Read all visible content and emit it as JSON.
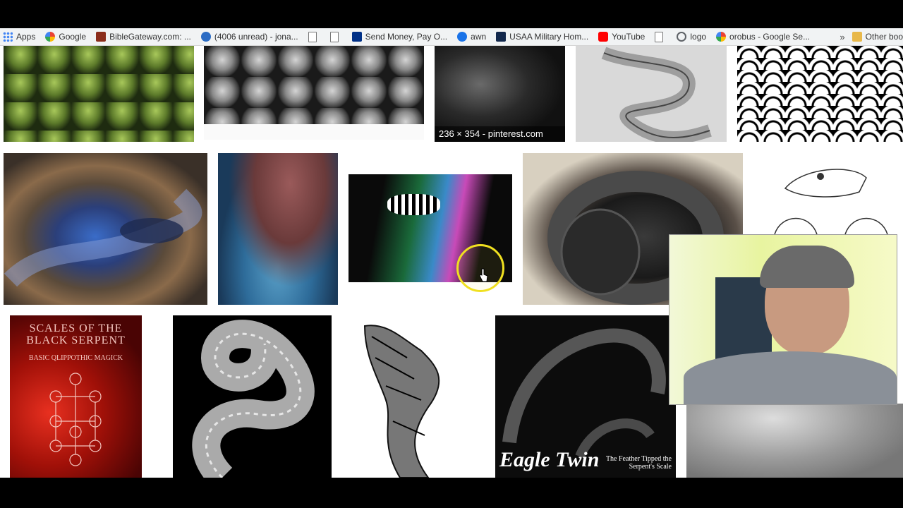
{
  "bookmarks_bar": {
    "items": [
      {
        "label": "Apps",
        "icon": "apps-grid-icon"
      },
      {
        "label": "Google",
        "icon": "google-icon"
      },
      {
        "label": "BibleGateway.com: ...",
        "icon": "biblegateway-icon"
      },
      {
        "label": "(4006 unread) - jona...",
        "icon": "mail-icon"
      },
      {
        "label": "",
        "icon": "page-icon"
      },
      {
        "label": "",
        "icon": "page-icon"
      },
      {
        "label": "Send Money, Pay O...",
        "icon": "paypal-icon"
      },
      {
        "label": "awn",
        "icon": "awn-icon"
      },
      {
        "label": "USAA Military Hom...",
        "icon": "usaa-icon"
      },
      {
        "label": "YouTube",
        "icon": "youtube-icon"
      },
      {
        "label": "",
        "icon": "page-icon"
      },
      {
        "label": "logo",
        "icon": "logo-icon"
      },
      {
        "label": "orobus - Google Se...",
        "icon": "google-icon"
      }
    ],
    "overflow": "»",
    "other_bookmarks": "Other boo"
  },
  "image_results": {
    "hover_caption": "236 × 354 - pinterest.com",
    "book_cover": {
      "title_line1": "SCALES OF THE",
      "title_line2": "BLACK SERPENT",
      "subtitle": "BASIC QLIPPOTHIC MAGICK"
    },
    "album_cover": {
      "title": "Eagle Twin",
      "subtitle": "The Feather Tipped the Serpent's Scale"
    }
  },
  "colors": {
    "bookmark_bar_bg": "#f1f3f4",
    "cursor_highlight": "#f0e020"
  }
}
